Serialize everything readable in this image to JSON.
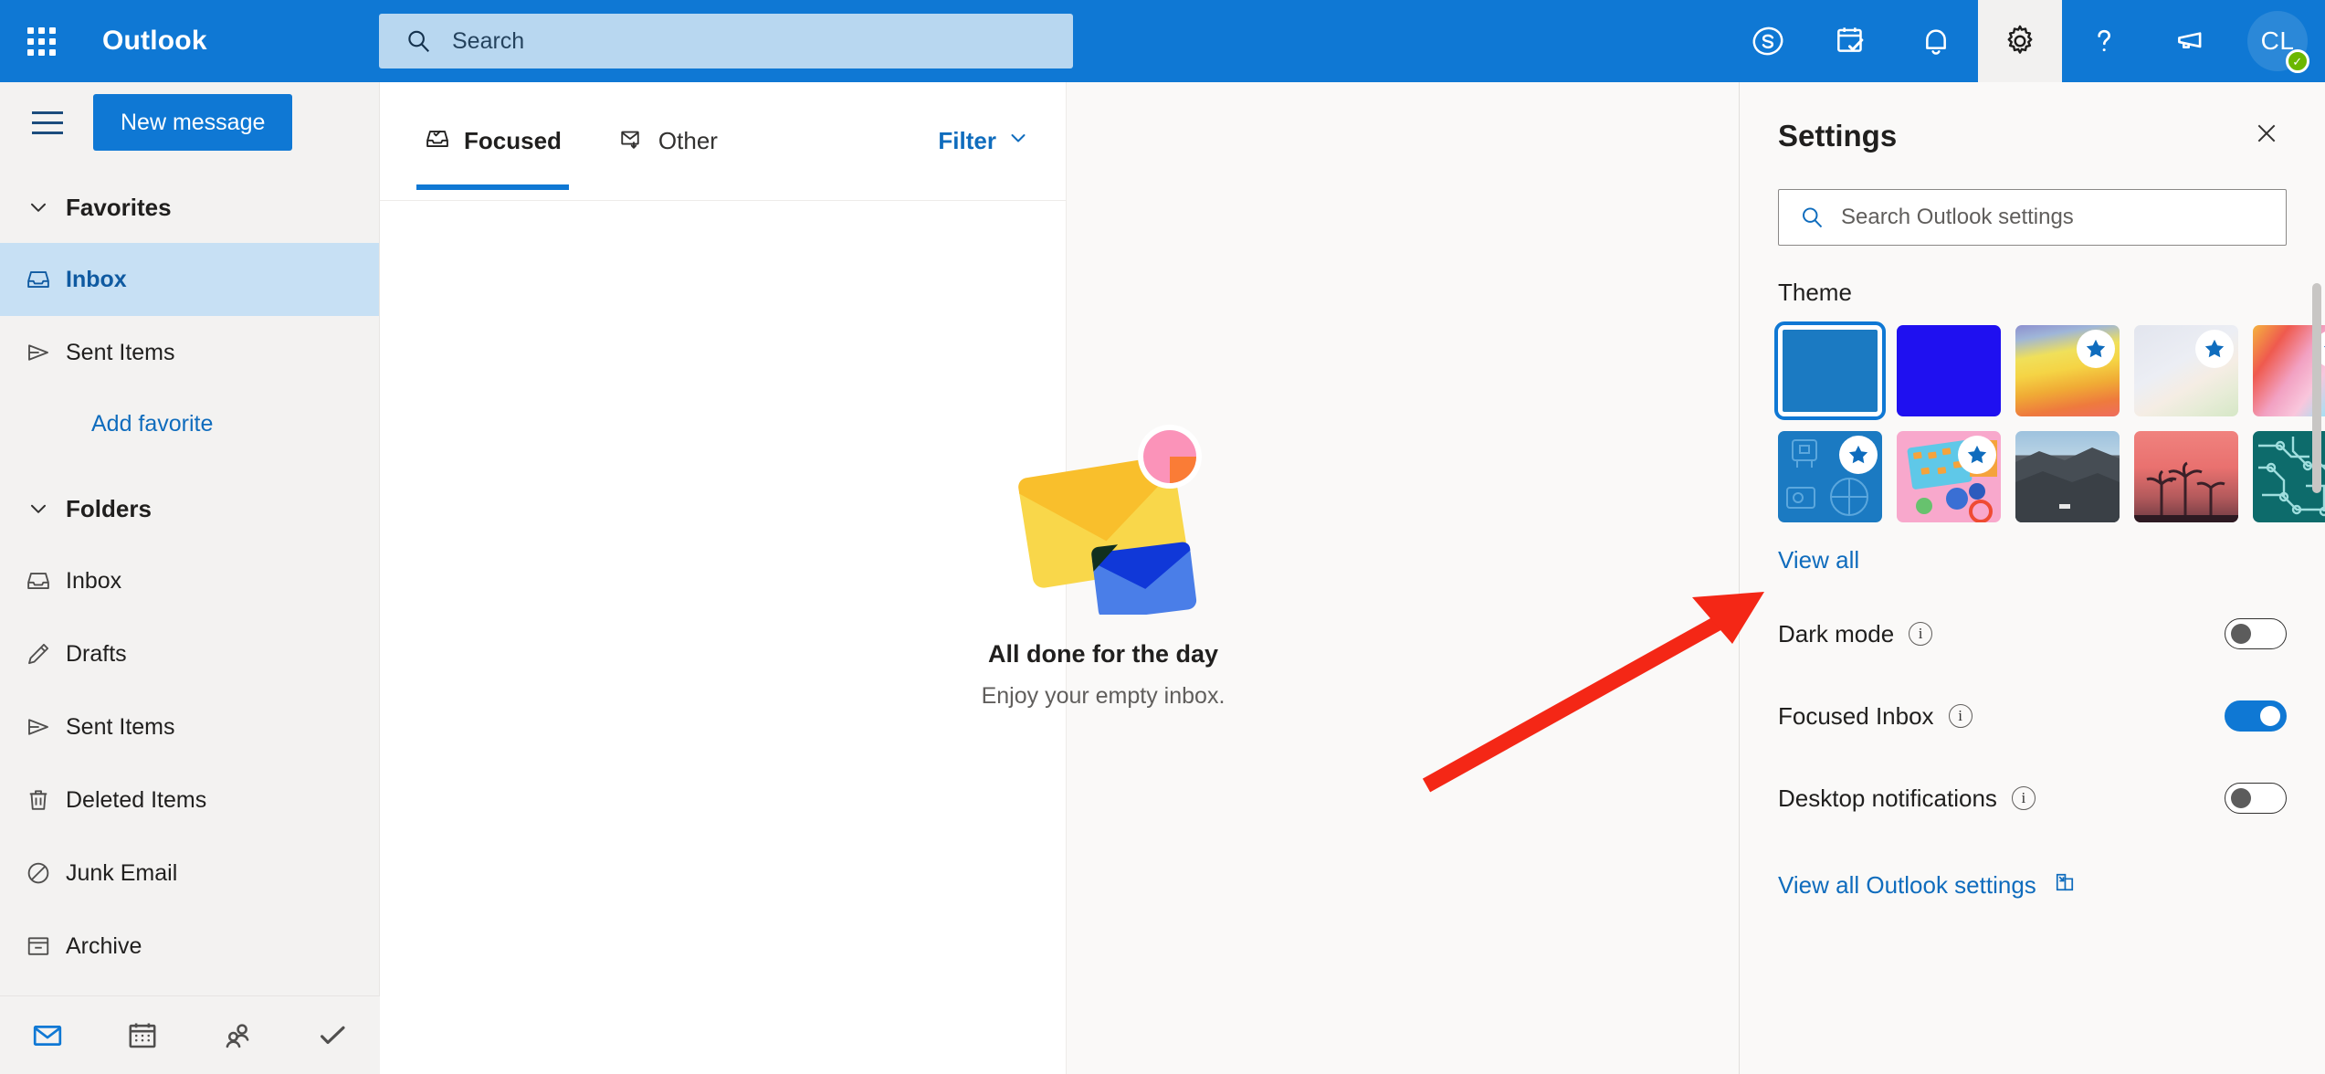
{
  "header": {
    "brand": "Outlook",
    "search_placeholder": "Search",
    "search_value": "",
    "waffle_name": "app-launcher",
    "icons": [
      {
        "name": "skype-icon",
        "label": "Skype"
      },
      {
        "name": "calendar-check-icon",
        "label": "My day"
      },
      {
        "name": "bell-icon",
        "label": "Notifications"
      },
      {
        "name": "gear-icon",
        "label": "Settings",
        "active": true
      },
      {
        "name": "help-icon",
        "label": "Help"
      },
      {
        "name": "megaphone-icon",
        "label": "Feedback"
      }
    ],
    "avatar_initials": "CL",
    "presence_status": "Available"
  },
  "sidebar": {
    "new_message_label": "New message",
    "favorites": {
      "label": "Favorites",
      "items": [
        {
          "label": "Inbox",
          "icon": "inbox-icon",
          "selected": true
        },
        {
          "label": "Sent Items",
          "icon": "send-icon",
          "selected": false
        }
      ],
      "add_favorite_label": "Add favorite"
    },
    "folders": {
      "label": "Folders",
      "items": [
        {
          "label": "Inbox",
          "icon": "inbox-icon"
        },
        {
          "label": "Drafts",
          "icon": "pencil-icon"
        },
        {
          "label": "Sent Items",
          "icon": "send-icon"
        },
        {
          "label": "Deleted Items",
          "icon": "trash-icon"
        },
        {
          "label": "Junk Email",
          "icon": "block-icon"
        },
        {
          "label": "Archive",
          "icon": "archive-icon"
        }
      ]
    },
    "bottom_nav": [
      {
        "name": "mail-icon",
        "label": "Mail",
        "active": true
      },
      {
        "name": "calendar-icon",
        "label": "Calendar",
        "active": false
      },
      {
        "name": "people-icon",
        "label": "People",
        "active": false
      },
      {
        "name": "todo-check-icon",
        "label": "To Do",
        "active": false
      }
    ]
  },
  "message_list": {
    "tabs": [
      {
        "label": "Focused",
        "icon": "focused-inbox-icon",
        "active": true
      },
      {
        "label": "Other",
        "icon": "other-mail-icon",
        "active": false
      }
    ],
    "filter_label": "Filter"
  },
  "empty_state": {
    "title": "All done for the day",
    "subtitle": "Enjoy your empty inbox."
  },
  "settings": {
    "title": "Settings",
    "close_label": "Close",
    "search_placeholder": "Search Outlook settings",
    "search_value": "",
    "theme_section_label": "Theme",
    "themes": [
      {
        "name": "theme-blue-default",
        "selected": true,
        "premium": false,
        "color": "#1b7ac2"
      },
      {
        "name": "theme-bright-blue",
        "selected": false,
        "premium": false,
        "color": "#1f10f0"
      },
      {
        "name": "theme-rainbow-stripes",
        "selected": false,
        "premium": true,
        "color": "#e8a23c"
      },
      {
        "name": "theme-white-ribbons",
        "selected": false,
        "premium": true,
        "color": "#e4e7ee"
      },
      {
        "name": "theme-unicorn",
        "selected": false,
        "premium": true,
        "color": "#f79dc3"
      },
      {
        "name": "theme-blueprint",
        "selected": false,
        "premium": true,
        "color": "#1b7ac2"
      },
      {
        "name": "theme-toys-pink",
        "selected": false,
        "premium": true,
        "color": "#f8a8cc"
      },
      {
        "name": "theme-mountain",
        "selected": false,
        "premium": false,
        "color": "#4a5560"
      },
      {
        "name": "theme-palm-sunset",
        "selected": false,
        "premium": false,
        "color": "#e0706e"
      },
      {
        "name": "theme-circuit",
        "selected": false,
        "premium": false,
        "color": "#0d6b6b"
      }
    ],
    "view_all_label": "View all",
    "toggles": [
      {
        "label": "Dark mode",
        "on": false
      },
      {
        "label": "Focused Inbox",
        "on": true
      },
      {
        "label": "Desktop notifications",
        "on": false
      }
    ],
    "view_all_settings_label": "View all Outlook settings"
  },
  "annotation": {
    "arrow_color": "#f42716",
    "points_at": "View all"
  }
}
